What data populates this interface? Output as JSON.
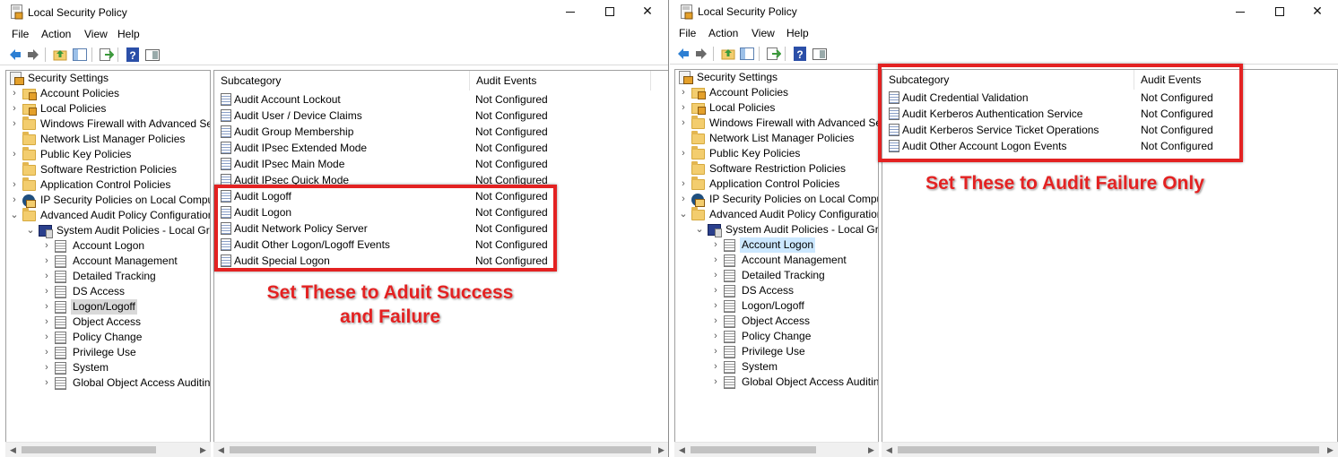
{
  "left": {
    "title": "Local Security Policy",
    "menu": [
      "File",
      "Action",
      "View",
      "Help"
    ],
    "tree": [
      {
        "label": "Security Settings",
        "icon": "root",
        "indent": 0,
        "chevron": ""
      },
      {
        "label": "Account Policies",
        "icon": "lockfolder",
        "indent": 1,
        "chevron": "›"
      },
      {
        "label": "Local Policies",
        "icon": "lockfolder",
        "indent": 1,
        "chevron": "›"
      },
      {
        "label": "Windows Firewall with Advanced Secu",
        "icon": "folder",
        "indent": 1,
        "chevron": "›"
      },
      {
        "label": "Network List Manager Policies",
        "icon": "folder",
        "indent": 1,
        "chevron": ""
      },
      {
        "label": "Public Key Policies",
        "icon": "folder",
        "indent": 1,
        "chevron": "›"
      },
      {
        "label": "Software Restriction Policies",
        "icon": "folder",
        "indent": 1,
        "chevron": ""
      },
      {
        "label": "Application Control Policies",
        "icon": "folder",
        "indent": 1,
        "chevron": "›"
      },
      {
        "label": "IP Security Policies on Local Compute",
        "icon": "ipsec",
        "indent": 1,
        "chevron": "›"
      },
      {
        "label": "Advanced Audit Policy Configuration",
        "icon": "folder",
        "indent": 1,
        "chevron": "⌄"
      },
      {
        "label": "System Audit Policies - Local Grou",
        "icon": "sys",
        "indent": 2,
        "chevron": "⌄"
      },
      {
        "label": "Account Logon",
        "icon": "policy",
        "indent": 3,
        "chevron": "›"
      },
      {
        "label": "Account Management",
        "icon": "policy",
        "indent": 3,
        "chevron": "›"
      },
      {
        "label": "Detailed Tracking",
        "icon": "policy",
        "indent": 3,
        "chevron": "›"
      },
      {
        "label": "DS Access",
        "icon": "policy",
        "indent": 3,
        "chevron": "›"
      },
      {
        "label": "Logon/Logoff",
        "icon": "policy",
        "indent": 3,
        "chevron": "›",
        "selected": "gray"
      },
      {
        "label": "Object Access",
        "icon": "policy",
        "indent": 3,
        "chevron": "›"
      },
      {
        "label": "Policy Change",
        "icon": "policy",
        "indent": 3,
        "chevron": "›"
      },
      {
        "label": "Privilege Use",
        "icon": "policy",
        "indent": 3,
        "chevron": "›"
      },
      {
        "label": "System",
        "icon": "policy",
        "indent": 3,
        "chevron": "›"
      },
      {
        "label": "Global Object Access Auditing",
        "icon": "policy",
        "indent": 3,
        "chevron": "›"
      }
    ],
    "columns": [
      "Subcategory",
      "Audit Events"
    ],
    "rows": [
      {
        "name": "Audit Account Lockout",
        "status": "Not Configured"
      },
      {
        "name": "Audit User / Device Claims",
        "status": "Not Configured"
      },
      {
        "name": "Audit Group Membership",
        "status": "Not Configured"
      },
      {
        "name": "Audit IPsec Extended Mode",
        "status": "Not Configured"
      },
      {
        "name": "Audit IPsec Main Mode",
        "status": "Not Configured"
      },
      {
        "name": "Audit IPsec Quick Mode",
        "status": "Not Configured"
      },
      {
        "name": "Audit Logoff",
        "status": "Not Configured"
      },
      {
        "name": "Audit Logon",
        "status": "Not Configured"
      },
      {
        "name": "Audit Network Policy Server",
        "status": "Not Configured"
      },
      {
        "name": "Audit Other Logon/Logoff Events",
        "status": "Not Configured"
      },
      {
        "name": "Audit Special Logon",
        "status": "Not Configured"
      }
    ],
    "annotation_lines": [
      "Set These to Aduit Success",
      "and Failure"
    ]
  },
  "right": {
    "title": "Local Security Policy",
    "menu": [
      "File",
      "Action",
      "View",
      "Help"
    ],
    "tree": [
      {
        "label": "Security Settings",
        "icon": "root",
        "indent": 0,
        "chevron": ""
      },
      {
        "label": "Account Policies",
        "icon": "lockfolder",
        "indent": 1,
        "chevron": "›"
      },
      {
        "label": "Local Policies",
        "icon": "lockfolder",
        "indent": 1,
        "chevron": "›"
      },
      {
        "label": "Windows Firewall with Advanced Secu",
        "icon": "folder",
        "indent": 1,
        "chevron": "›"
      },
      {
        "label": "Network List Manager Policies",
        "icon": "folder",
        "indent": 1,
        "chevron": ""
      },
      {
        "label": "Public Key Policies",
        "icon": "folder",
        "indent": 1,
        "chevron": "›"
      },
      {
        "label": "Software Restriction Policies",
        "icon": "folder",
        "indent": 1,
        "chevron": ""
      },
      {
        "label": "Application Control Policies",
        "icon": "folder",
        "indent": 1,
        "chevron": "›"
      },
      {
        "label": "IP Security Policies on Local Compute",
        "icon": "ipsec",
        "indent": 1,
        "chevron": "›"
      },
      {
        "label": "Advanced Audit Policy Configuration",
        "icon": "folder",
        "indent": 1,
        "chevron": "⌄"
      },
      {
        "label": "System Audit Policies - Local Grou",
        "icon": "sys",
        "indent": 2,
        "chevron": "⌄"
      },
      {
        "label": "Account Logon",
        "icon": "policy",
        "indent": 3,
        "chevron": "›",
        "selected": "blue"
      },
      {
        "label": "Account Management",
        "icon": "policy",
        "indent": 3,
        "chevron": "›"
      },
      {
        "label": "Detailed Tracking",
        "icon": "policy",
        "indent": 3,
        "chevron": "›"
      },
      {
        "label": "DS Access",
        "icon": "policy",
        "indent": 3,
        "chevron": "›"
      },
      {
        "label": "Logon/Logoff",
        "icon": "policy",
        "indent": 3,
        "chevron": "›"
      },
      {
        "label": "Object Access",
        "icon": "policy",
        "indent": 3,
        "chevron": "›"
      },
      {
        "label": "Policy Change",
        "icon": "policy",
        "indent": 3,
        "chevron": "›"
      },
      {
        "label": "Privilege Use",
        "icon": "policy",
        "indent": 3,
        "chevron": "›"
      },
      {
        "label": "System",
        "icon": "policy",
        "indent": 3,
        "chevron": "›"
      },
      {
        "label": "Global Object Access Auditing",
        "icon": "policy",
        "indent": 3,
        "chevron": "›"
      }
    ],
    "columns": [
      "Subcategory",
      "Audit Events"
    ],
    "rows": [
      {
        "name": "Audit Credential Validation",
        "status": "Not Configured"
      },
      {
        "name": "Audit Kerberos Authentication Service",
        "status": "Not Configured"
      },
      {
        "name": "Audit Kerberos Service Ticket Operations",
        "status": "Not Configured"
      },
      {
        "name": "Audit Other Account Logon Events",
        "status": "Not Configured"
      }
    ],
    "annotation_lines": [
      "Set These to Audit Failure Only"
    ]
  },
  "colors": {
    "highlight": "#e32222",
    "selection_blue": "#cce8ff",
    "selection_gray": "#d9d9d9"
  }
}
